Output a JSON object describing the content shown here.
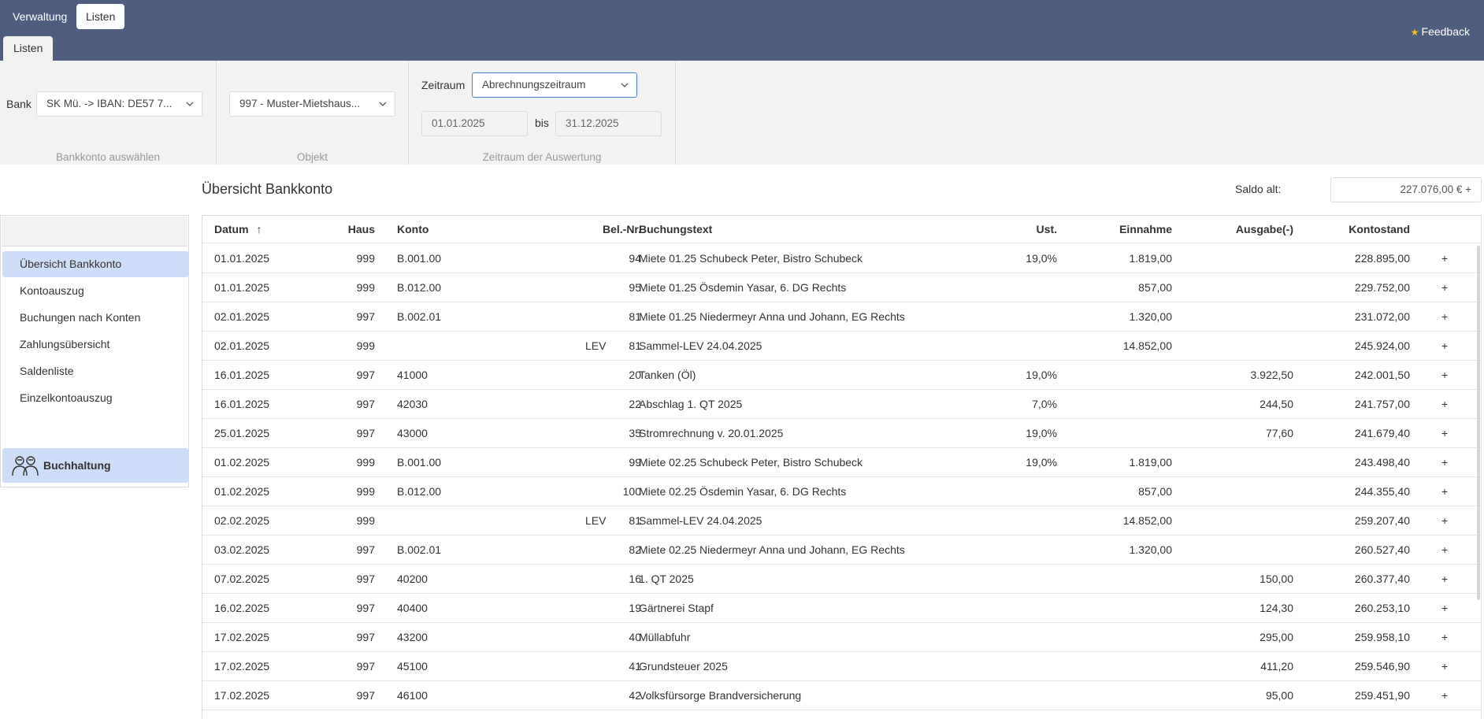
{
  "header": {
    "menu_tabs": [
      "Verwaltung",
      "Listen"
    ],
    "sub_tab": "Listen",
    "feedback": "Feedback"
  },
  "filters": {
    "bank": {
      "label": "Bank",
      "value": "SK Mü. -> IBAN: DE57 7...",
      "caption": "Bankkonto auswählen"
    },
    "objekt": {
      "value": "997 - Muster-Mietshaus...",
      "caption": "Objekt"
    },
    "zeitraum": {
      "label": "Zeitraum",
      "value": "Abrechnungszeitraum",
      "from": "01.01.2025",
      "to_label": "bis",
      "to": "31.12.2025",
      "caption": "Zeitraum der Auswertung"
    }
  },
  "sidebar": {
    "items": [
      "Übersicht Bankkonto",
      "Kontoauszug",
      "Buchungen nach Konten",
      "Zahlungsübersicht",
      "Saldenliste",
      "Einzelkontoauszug"
    ],
    "module": "Buchhaltung"
  },
  "main": {
    "title": "Übersicht Bankkonto",
    "saldo_label": "Saldo alt:",
    "saldo_value": "227.076,00 € +"
  },
  "table": {
    "columns": {
      "datum": "Datum",
      "haus": "Haus",
      "konto": "Konto",
      "beleg": "Bel.-Nr.",
      "text": "Buchungstext",
      "ust": "Ust.",
      "einnahme": "Einnahme",
      "ausgabe": "Ausgabe(-)",
      "kontostand": "Kontostand"
    },
    "sort_icon": "↑",
    "action_symbol": "+",
    "rows": [
      {
        "datum": "01.01.2025",
        "haus": "999",
        "konto": "B.001.00",
        "beleg": "94",
        "typ": "",
        "text": "Miete 01.25 Schubeck Peter, Bistro Schubeck",
        "ust": "19,0%",
        "einnahme": "1.819,00",
        "ausgabe": "",
        "kontostand": "228.895,00"
      },
      {
        "datum": "01.01.2025",
        "haus": "999",
        "konto": "B.012.00",
        "beleg": "95",
        "typ": "",
        "text": "Miete 01.25 Ösdemin Yasar, 6. DG Rechts",
        "ust": "",
        "einnahme": "857,00",
        "ausgabe": "",
        "kontostand": "229.752,00"
      },
      {
        "datum": "02.01.2025",
        "haus": "997",
        "konto": "B.002.01",
        "beleg": "81",
        "typ": "",
        "text": "Miete 01.25 Niedermeyr Anna und Johann, EG Rechts",
        "ust": "",
        "einnahme": "1.320,00",
        "ausgabe": "",
        "kontostand": "231.072,00"
      },
      {
        "datum": "02.01.2025",
        "haus": "999",
        "konto": "",
        "beleg": "81",
        "typ": "LEV",
        "text": "Sammel-LEV 24.04.2025",
        "ust": "",
        "einnahme": "14.852,00",
        "ausgabe": "",
        "kontostand": "245.924,00"
      },
      {
        "datum": "16.01.2025",
        "haus": "997",
        "konto": "41000",
        "beleg": "20",
        "typ": "",
        "text": "Tanken (Öl)",
        "ust": "19,0%",
        "einnahme": "",
        "ausgabe": "3.922,50",
        "kontostand": "242.001,50"
      },
      {
        "datum": "16.01.2025",
        "haus": "997",
        "konto": "42030",
        "beleg": "22",
        "typ": "",
        "text": "Abschlag 1. QT 2025",
        "ust": "7,0%",
        "einnahme": "",
        "ausgabe": "244,50",
        "kontostand": "241.757,00"
      },
      {
        "datum": "25.01.2025",
        "haus": "997",
        "konto": "43000",
        "beleg": "35",
        "typ": "",
        "text": "Stromrechnung v. 20.01.2025",
        "ust": "19,0%",
        "einnahme": "",
        "ausgabe": "77,60",
        "kontostand": "241.679,40"
      },
      {
        "datum": "01.02.2025",
        "haus": "999",
        "konto": "B.001.00",
        "beleg": "99",
        "typ": "",
        "text": "Miete 02.25 Schubeck Peter, Bistro Schubeck",
        "ust": "19,0%",
        "einnahme": "1.819,00",
        "ausgabe": "",
        "kontostand": "243.498,40"
      },
      {
        "datum": "01.02.2025",
        "haus": "999",
        "konto": "B.012.00",
        "beleg": "100",
        "typ": "",
        "text": "Miete 02.25 Ösdemin Yasar, 6. DG Rechts",
        "ust": "",
        "einnahme": "857,00",
        "ausgabe": "",
        "kontostand": "244.355,40"
      },
      {
        "datum": "02.02.2025",
        "haus": "999",
        "konto": "",
        "beleg": "81",
        "typ": "LEV",
        "text": "Sammel-LEV 24.04.2025",
        "ust": "",
        "einnahme": "14.852,00",
        "ausgabe": "",
        "kontostand": "259.207,40"
      },
      {
        "datum": "03.02.2025",
        "haus": "997",
        "konto": "B.002.01",
        "beleg": "82",
        "typ": "",
        "text": "Miete 02.25 Niedermeyr Anna und Johann, EG Rechts",
        "ust": "",
        "einnahme": "1.320,00",
        "ausgabe": "",
        "kontostand": "260.527,40"
      },
      {
        "datum": "07.02.2025",
        "haus": "997",
        "konto": "40200",
        "beleg": "16",
        "typ": "",
        "text": "1. QT 2025",
        "ust": "",
        "einnahme": "",
        "ausgabe": "150,00",
        "kontostand": "260.377,40"
      },
      {
        "datum": "16.02.2025",
        "haus": "997",
        "konto": "40400",
        "beleg": "19",
        "typ": "",
        "text": "Gärtnerei Stapf",
        "ust": "",
        "einnahme": "",
        "ausgabe": "124,30",
        "kontostand": "260.253,10"
      },
      {
        "datum": "17.02.2025",
        "haus": "997",
        "konto": "43200",
        "beleg": "40",
        "typ": "",
        "text": "Müllabfuhr",
        "ust": "",
        "einnahme": "",
        "ausgabe": "295,00",
        "kontostand": "259.958,10"
      },
      {
        "datum": "17.02.2025",
        "haus": "997",
        "konto": "45100",
        "beleg": "41",
        "typ": "",
        "text": "Grundsteuer 2025",
        "ust": "",
        "einnahme": "",
        "ausgabe": "411,20",
        "kontostand": "259.546,90"
      },
      {
        "datum": "17.02.2025",
        "haus": "997",
        "konto": "46100",
        "beleg": "42",
        "typ": "",
        "text": "Volksfürsorge Brandversicherung",
        "ust": "",
        "einnahme": "",
        "ausgabe": "95,00",
        "kontostand": "259.451,90"
      }
    ]
  }
}
